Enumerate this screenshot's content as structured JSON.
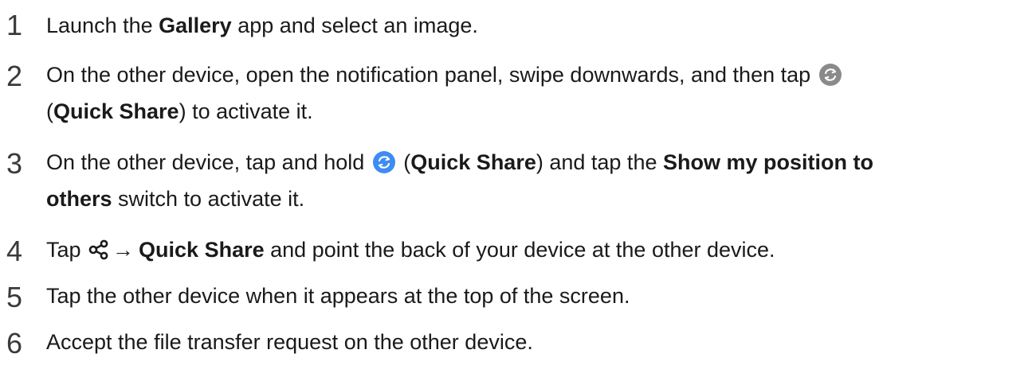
{
  "steps": [
    {
      "number": "1",
      "parts": {
        "a": "Launch the ",
        "b_bold": "Gallery",
        "c": " app and select an image."
      }
    },
    {
      "number": "2",
      "line1": {
        "a": "On the other device, open the notification panel, swipe downwards, and then tap "
      },
      "icon": "quick-share-icon-grey",
      "line2": {
        "a": "(",
        "b_bold": "Quick Share",
        "c": ") to activate it."
      }
    },
    {
      "number": "3",
      "line1": {
        "a": "On the other device, tap and hold ",
        "icon": "quick-share-icon-blue",
        "b": " (",
        "c_bold": "Quick Share",
        "d": ") and tap the ",
        "e_bold": "Show my position to"
      },
      "line2": {
        "a_bold": "others",
        "b": " switch to activate it."
      }
    },
    {
      "number": "4",
      "parts": {
        "a": "Tap ",
        "icon": "share-icon",
        "arrow": "→",
        "b_bold": "Quick Share",
        "c": " and point the back of your device at the other device."
      }
    },
    {
      "number": "5",
      "parts": {
        "a": "Tap the other device when it appears at the top of the screen."
      }
    },
    {
      "number": "6",
      "parts": {
        "a": "Accept the file transfer request on the other device."
      }
    }
  ],
  "colors": {
    "text": "#1a1a1a",
    "step_number": "#3a3a3a",
    "quick_share_blue": "#3d8cf2",
    "quick_share_grey": "#8a8a8a"
  }
}
